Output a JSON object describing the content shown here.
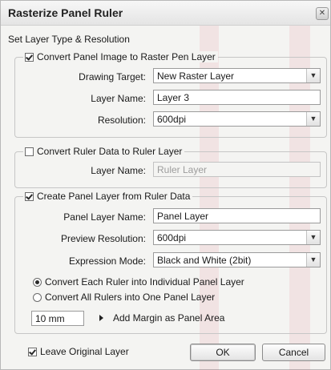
{
  "dialog": {
    "title": "Rasterize Panel Ruler",
    "close_glyph": "✕",
    "section_heading": "Set Layer Type & Resolution"
  },
  "raster_group": {
    "checkbox_label": "Convert Panel Image to Raster Pen Layer",
    "checked": true,
    "drawing_target_label": "Drawing Target:",
    "drawing_target_value": "New Raster Layer",
    "layer_name_label": "Layer Name:",
    "layer_name_value": "Layer 3",
    "resolution_label": "Resolution:",
    "resolution_value": "600dpi"
  },
  "ruler_group": {
    "checkbox_label": "Convert Ruler Data to Ruler Layer",
    "checked": false,
    "layer_name_label": "Layer Name:",
    "layer_name_placeholder": "Ruler Layer"
  },
  "panel_group": {
    "checkbox_label": "Create Panel Layer from Ruler Data",
    "checked": true,
    "panel_layer_name_label": "Panel Layer Name:",
    "panel_layer_name_value": "Panel Layer",
    "preview_resolution_label": "Preview Resolution:",
    "preview_resolution_value": "600dpi",
    "expression_mode_label": "Expression Mode:",
    "expression_mode_value": "Black and White (2bit)",
    "radio_individual_label": "Convert Each Ruler into Individual Panel Layer",
    "radio_one_label": "Convert All Rulers into One Panel Layer",
    "margin_value": "10 mm",
    "margin_label": "Add Margin as Panel Area"
  },
  "footer": {
    "leave_original_label": "Leave Original Layer",
    "leave_original_checked": true,
    "ok_label": "OK",
    "cancel_label": "Cancel"
  },
  "icons": {
    "dropdown_arrow": "▼"
  },
  "colors": {
    "dialog_bg": "#f4f4f2",
    "border": "#9b9b9b",
    "text": "#1a1a1a",
    "disabled_text": "#9c9c9c"
  }
}
